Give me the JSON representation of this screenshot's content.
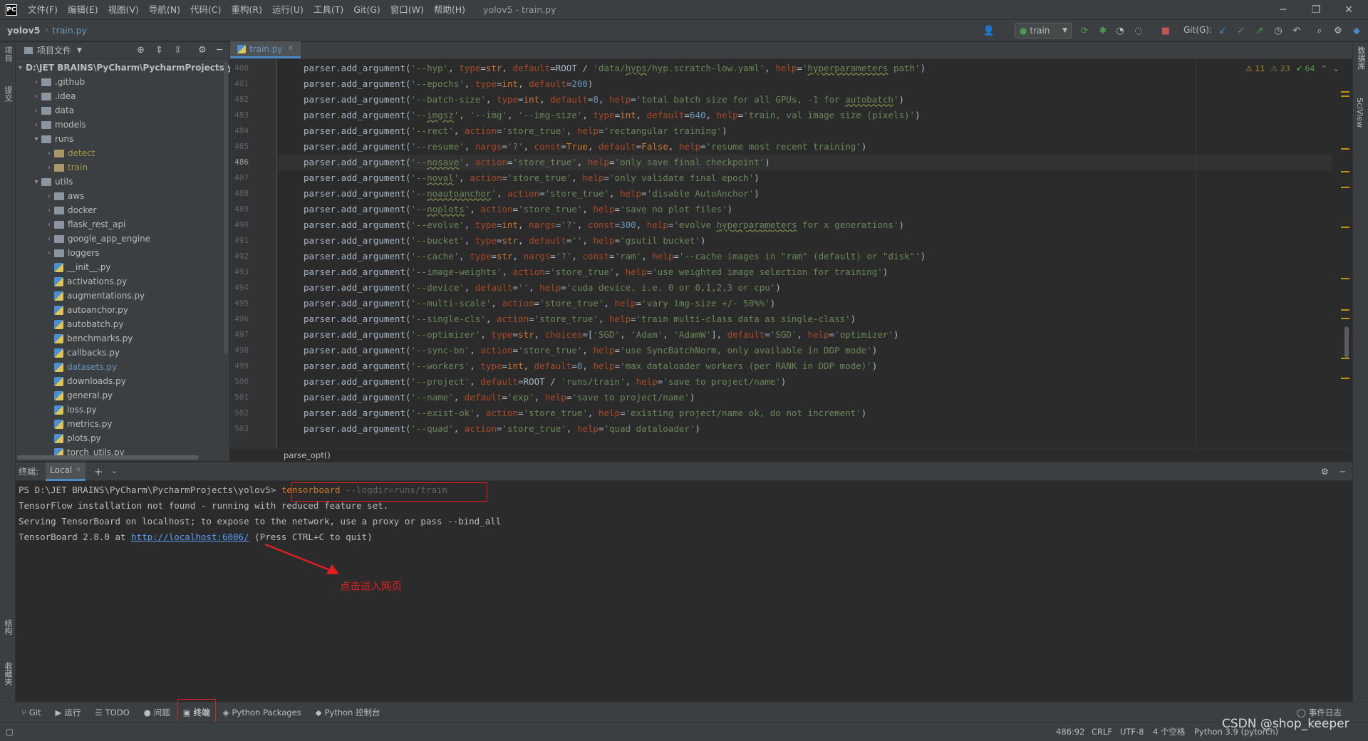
{
  "titlebar": {
    "logo": "PC",
    "menus": [
      "文件(F)",
      "编辑(E)",
      "视图(V)",
      "导航(N)",
      "代码(C)",
      "重构(R)",
      "运行(U)",
      "工具(T)",
      "Git(G)",
      "窗口(W)",
      "帮助(H)"
    ],
    "window_title": "yolov5 - train.py"
  },
  "navbar": {
    "project": "yolov5",
    "file": "train.py",
    "run_config": "train",
    "git_label": "Git(G):"
  },
  "left_strip": {
    "project_label": "项目",
    "commit_label": "提交",
    "structure_label": "结构",
    "bookmarks_label": "收藏夹"
  },
  "right_strip": {
    "db_label": "数据库",
    "sciview_label": "SciView"
  },
  "project_panel": {
    "title": "项目文件",
    "tree": [
      {
        "label": "D:\\JET BRAINS\\PyCharm\\PycharmProjects\\yolov5",
        "depth": 0,
        "kind": "folder",
        "open": true,
        "bold": true
      },
      {
        "label": ".github",
        "depth": 1,
        "kind": "folder"
      },
      {
        "label": ".idea",
        "depth": 1,
        "kind": "folder"
      },
      {
        "label": "data",
        "depth": 1,
        "kind": "folder"
      },
      {
        "label": "models",
        "depth": 1,
        "kind": "folder"
      },
      {
        "label": "runs",
        "depth": 1,
        "kind": "folder",
        "open": true
      },
      {
        "label": "detect",
        "depth": 2,
        "kind": "folder-yellow",
        "style": "muted-yellow"
      },
      {
        "label": "train",
        "depth": 2,
        "kind": "folder-yellow",
        "style": "muted-yellow"
      },
      {
        "label": "utils",
        "depth": 1,
        "kind": "folder",
        "open": true
      },
      {
        "label": "aws",
        "depth": 2,
        "kind": "folder"
      },
      {
        "label": "docker",
        "depth": 2,
        "kind": "folder"
      },
      {
        "label": "flask_rest_api",
        "depth": 2,
        "kind": "folder"
      },
      {
        "label": "google_app_engine",
        "depth": 2,
        "kind": "folder"
      },
      {
        "label": "loggers",
        "depth": 2,
        "kind": "folder"
      },
      {
        "label": "__init__.py",
        "depth": 2,
        "kind": "py"
      },
      {
        "label": "activations.py",
        "depth": 2,
        "kind": "py"
      },
      {
        "label": "augmentations.py",
        "depth": 2,
        "kind": "py"
      },
      {
        "label": "autoanchor.py",
        "depth": 2,
        "kind": "py"
      },
      {
        "label": "autobatch.py",
        "depth": 2,
        "kind": "py"
      },
      {
        "label": "benchmarks.py",
        "depth": 2,
        "kind": "py"
      },
      {
        "label": "callbacks.py",
        "depth": 2,
        "kind": "py"
      },
      {
        "label": "datasets.py",
        "depth": 2,
        "kind": "py",
        "style": "blue"
      },
      {
        "label": "downloads.py",
        "depth": 2,
        "kind": "py"
      },
      {
        "label": "general.py",
        "depth": 2,
        "kind": "py"
      },
      {
        "label": "loss.py",
        "depth": 2,
        "kind": "py"
      },
      {
        "label": "metrics.py",
        "depth": 2,
        "kind": "py"
      },
      {
        "label": "plots.py",
        "depth": 2,
        "kind": "py"
      },
      {
        "label": "torch_utils.py",
        "depth": 2,
        "kind": "py"
      }
    ]
  },
  "editor": {
    "tab_label": "train.py",
    "inspection": {
      "warnings": "⚠ 11",
      "weak_warnings": "⚠ 23",
      "ok": "✔ 64"
    },
    "function_breadcrumb": "parse_opt()",
    "current_line": 486,
    "lines": [
      {
        "n": 480,
        "html": "parser.add_argument(<span class='s'>'--hyp'</span>, <span class='p'>type</span>=<span class='k'>str</span>, <span class='p'>default</span>=ROOT / <span class='s'>'data/<span class=\"u\">hyps</span>/hyp.scratch-low.yaml'</span>, <span class='p'>help</span>=<span class='s'>'<span class=\"u\">hyperparameters</span> path'</span>)"
      },
      {
        "n": 481,
        "html": "parser.add_argument(<span class='s'>'--epochs'</span>, <span class='p'>type</span>=<span class='k'>int</span>, <span class='p'>default</span>=<span class='n'>200</span>)"
      },
      {
        "n": 482,
        "html": "parser.add_argument(<span class='s'>'--batch-size'</span>, <span class='p'>type</span>=<span class='k'>int</span>, <span class='p'>default</span>=<span class='n'>8</span>, <span class='p'>help</span>=<span class='s'>'total batch size for all GPUs, -1 for <span class=\"u\">autobatch</span>'</span>)"
      },
      {
        "n": 483,
        "html": "parser.add_argument(<span class='s'>'--<span class=\"u\">imgsz</span>'</span>, <span class='s'>'--img'</span>, <span class='s'>'--img-size'</span>, <span class='p'>type</span>=<span class='k'>int</span>, <span class='p'>default</span>=<span class='n'>640</span>, <span class='p'>help</span>=<span class='s'>'train, val image size (pixels)'</span>)"
      },
      {
        "n": 484,
        "html": "parser.add_argument(<span class='s'>'--rect'</span>, <span class='p'>action</span>=<span class='s'>'store_true'</span>, <span class='p'>help</span>=<span class='s'>'rectangular training'</span>)"
      },
      {
        "n": 485,
        "html": "parser.add_argument(<span class='s'>'--resume'</span>, <span class='p'>nargs</span>=<span class='s'>'?'</span>, <span class='p'>const</span>=<span class='k'>True</span>, <span class='p'>default</span>=<span class='k'>False</span>, <span class='p'>help</span>=<span class='s'>'resume most recent training'</span>)"
      },
      {
        "n": 486,
        "html": "parser.add_argument(<span class='s'>'--<span class=\"u\">nosave</span>'</span>, <span class='p'>action</span>=<span class='s'>'store_true'</span>, <span class='p'>help</span>=<span class='s'>'only save final checkpoint'</span>)"
      },
      {
        "n": 487,
        "html": "parser.add_argument(<span class='s'>'--<span class=\"u\">noval</span>'</span>, <span class='p'>action</span>=<span class='s'>'store_true'</span>, <span class='p'>help</span>=<span class='s'>'only validate final epoch'</span>)"
      },
      {
        "n": 488,
        "html": "parser.add_argument(<span class='s'>'--<span class=\"u\">noautoanchor</span>'</span>, <span class='p'>action</span>=<span class='s'>'store_true'</span>, <span class='p'>help</span>=<span class='s'>'disable AutoAnchor'</span>)"
      },
      {
        "n": 489,
        "html": "parser.add_argument(<span class='s'>'--<span class=\"u\">noplots</span>'</span>, <span class='p'>action</span>=<span class='s'>'store_true'</span>, <span class='p'>help</span>=<span class='s'>'save no plot files'</span>)"
      },
      {
        "n": 490,
        "html": "parser.add_argument(<span class='s'>'--evolve'</span>, <span class='p'>type</span>=<span class='k'>int</span>, <span class='p'>nargs</span>=<span class='s'>'?'</span>, <span class='p'>const</span>=<span class='n'>300</span>, <span class='p'>help</span>=<span class='s'>'evolve <span class=\"u\">hyperparameters</span> for x generations'</span>)"
      },
      {
        "n": 491,
        "html": "parser.add_argument(<span class='s'>'--bucket'</span>, <span class='p'>type</span>=<span class='k'>str</span>, <span class='p'>default</span>=<span class='s'>''</span>, <span class='p'>help</span>=<span class='s'>'gsutil bucket'</span>)"
      },
      {
        "n": 492,
        "html": "parser.add_argument(<span class='s'>'--cache'</span>, <span class='p'>type</span>=<span class='k'>str</span>, <span class='p'>nargs</span>=<span class='s'>'?'</span>, <span class='p'>const</span>=<span class='s'>'ram'</span>, <span class='p'>help</span>=<span class='s'>'--cache images in \"ram\" (default) or \"disk\"'</span>)"
      },
      {
        "n": 493,
        "html": "parser.add_argument(<span class='s'>'--image-weights'</span>, <span class='p'>action</span>=<span class='s'>'store_true'</span>, <span class='p'>help</span>=<span class='s'>'use weighted image selection for training'</span>)"
      },
      {
        "n": 494,
        "html": "parser.add_argument(<span class='s'>'--device'</span>, <span class='p'>default</span>=<span class='s'>''</span>, <span class='p'>help</span>=<span class='s'>'cuda device, i.e. 0 or 0,1,2,3 or cpu'</span>)"
      },
      {
        "n": 495,
        "html": "parser.add_argument(<span class='s'>'--multi-scale'</span>, <span class='p'>action</span>=<span class='s'>'store_true'</span>, <span class='p'>help</span>=<span class='s'>'vary img-size +/- 50%%'</span>)"
      },
      {
        "n": 496,
        "html": "parser.add_argument(<span class='s'>'--single-cls'</span>, <span class='p'>action</span>=<span class='s'>'store_true'</span>, <span class='p'>help</span>=<span class='s'>'train multi-class data as single-class'</span>)"
      },
      {
        "n": 497,
        "html": "parser.add_argument(<span class='s'>'--optimizer'</span>, <span class='p'>type</span>=<span class='k'>str</span>, <span class='p'>choices</span>=[<span class='s'>'SGD'</span>, <span class='s'>'Adam'</span>, <span class='s'>'AdamW'</span>], <span class='p'>default</span>=<span class='s'>'SGD'</span>, <span class='p'>help</span>=<span class='s'>'optimizer'</span>)"
      },
      {
        "n": 498,
        "html": "parser.add_argument(<span class='s'>'--sync-bn'</span>, <span class='p'>action</span>=<span class='s'>'store_true'</span>, <span class='p'>help</span>=<span class='s'>'use SyncBatchNorm, only available in DDP mode'</span>)"
      },
      {
        "n": 499,
        "html": "parser.add_argument(<span class='s'>'--workers'</span>, <span class='p'>type</span>=<span class='k'>int</span>, <span class='p'>default</span>=<span class='n'>8</span>, <span class='p'>help</span>=<span class='s'>'max dataloader workers (per RANK in DDP mode)'</span>)"
      },
      {
        "n": 500,
        "html": "parser.add_argument(<span class='s'>'--project'</span>, <span class='p'>default</span>=ROOT / <span class='s'>'runs/train'</span>, <span class='p'>help</span>=<span class='s'>'save to project/name'</span>)"
      },
      {
        "n": 501,
        "html": "parser.add_argument(<span class='s'>'--name'</span>, <span class='p'>default</span>=<span class='s'>'exp'</span>, <span class='p'>help</span>=<span class='s'>'save to project/name'</span>)"
      },
      {
        "n": 502,
        "html": "parser.add_argument(<span class='s'>'--exist-ok'</span>, <span class='p'>action</span>=<span class='s'>'store_true'</span>, <span class='p'>help</span>=<span class='s'>'existing project/name ok, do not increment'</span>)"
      },
      {
        "n": 503,
        "html": "parser.add_argument(<span class='s'>'--quad'</span>, <span class='p'>action</span>=<span class='s'>'store_true'</span>, <span class='p'>help</span>=<span class='s'>'quad dataloader'</span>)"
      }
    ]
  },
  "terminal": {
    "title": "终端:",
    "tab_label": "Local",
    "prompt": "PS D:\\JET BRAINS\\PyCharm\\PycharmProjects\\yolov5>",
    "command": "tensorboard",
    "command_args": " --logdir=runs/train",
    "output": [
      "TensorFlow installation not found - running with reduced feature set.",
      "Serving TensorBoard on localhost; to expose to the network, use a proxy or pass --bind_all"
    ],
    "url_line_prefix": "TensorBoard 2.8.0 at ",
    "url": "http://localhost:6006/",
    "url_line_suffix": " (Press CTRL+C to quit)",
    "annotation": "点击进入网页"
  },
  "toolwindows": [
    {
      "label": "Git",
      "icon": "⑂"
    },
    {
      "label": "运行",
      "icon": "▶"
    },
    {
      "label": "TODO",
      "icon": "☰"
    },
    {
      "label": "问题",
      "icon": "●"
    },
    {
      "label": "终端",
      "icon": "▣",
      "active": true
    },
    {
      "label": "Python Packages",
      "icon": "◈"
    },
    {
      "label": "Python 控制台",
      "icon": "◆"
    }
  ],
  "event_log": "事件日志",
  "status_bar": {
    "position": "486:92",
    "line_sep": "CRLF",
    "encoding": "UTF-8",
    "indent": "4 个空格",
    "interpreter": "Python 3.9 (pytorch)"
  },
  "watermark": "CSDN @shop_keeper"
}
